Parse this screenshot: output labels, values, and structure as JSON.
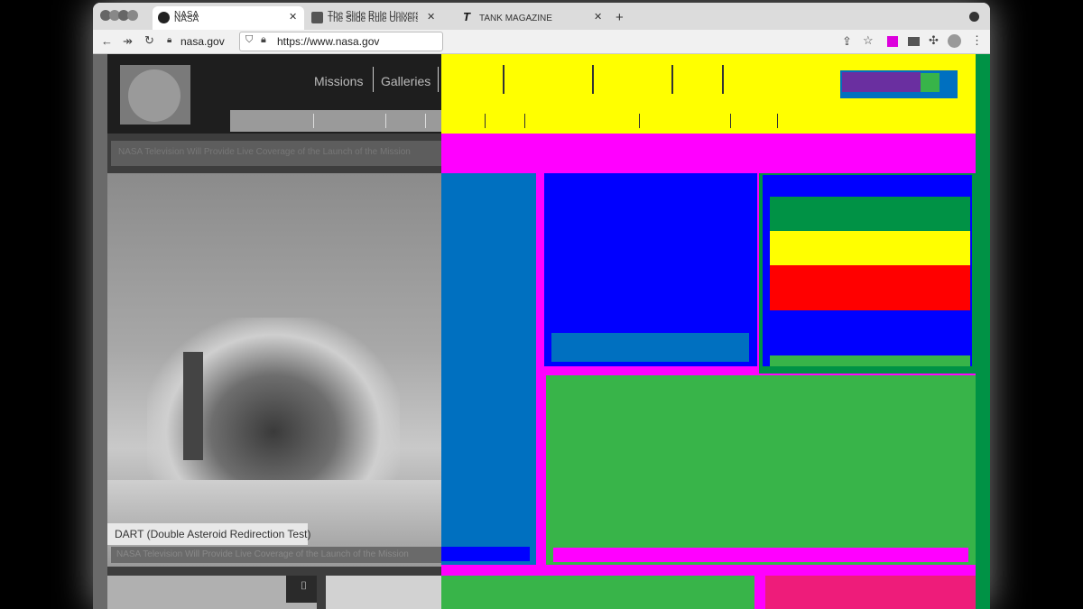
{
  "tabs": [
    {
      "title_line1": "NASA",
      "title_line2": "NASA",
      "close": "✕"
    },
    {
      "title_line1": "The Slide Rule Universe, literally",
      "title_line2": "The Slide Rule Universe, literally",
      "close": "✕"
    },
    {
      "title_line1": "TANK MAGAZINE",
      "close": "✕"
    }
  ],
  "new_tab": "+",
  "address": {
    "domain": "nasa.gov",
    "url": "https://www.nasa.gov"
  },
  "nasa": {
    "nav": [
      "Missions",
      "Galleries"
    ],
    "feature_caption": "DART (Double Asteroid Redirection Test)",
    "banner_text": "NASA Television Will Provide Live Coverage of the Launch of the Mission",
    "subcaption": "NASA Television Will Provide Live Coverage of the Launch of the Mission"
  },
  "colors": {
    "yellow": "#ffff00",
    "magenta": "#ff00ff",
    "blue": "#0000ff",
    "steel": "#0070c0",
    "green": "#38b449",
    "darkgreen": "#009245",
    "red": "#ff0000",
    "purple": "#6a2fa0",
    "pink": "#ee1c7a"
  },
  "icons": [
    "back-icon",
    "forward-icon",
    "reload-icon",
    "lock-icon",
    "shield-icon",
    "share-icon",
    "star-icon",
    "extension-icon",
    "puzzle-icon",
    "profile-icon",
    "menu-icon",
    "camera-icon"
  ]
}
